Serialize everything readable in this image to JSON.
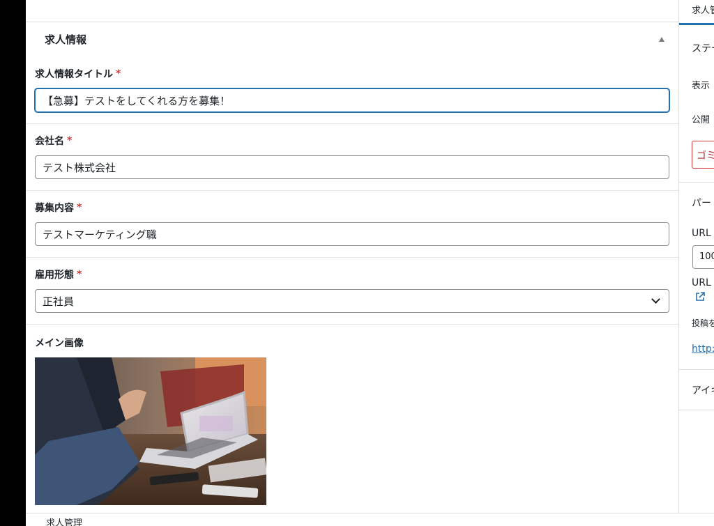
{
  "section": {
    "title": "求人情報"
  },
  "fields": {
    "job_title": {
      "label": "求人情報タイトル",
      "required_mark": "*",
      "value": "【急募】テストをしてくれる方を募集！"
    },
    "company": {
      "label": "会社名",
      "required_mark": "*",
      "value": "テスト株式会社"
    },
    "recruitment": {
      "label": "募集内容",
      "required_mark": "*",
      "value": "テストマーケティング職"
    },
    "employment_type": {
      "label": "雇用形態",
      "required_mark": "*",
      "value": "正社員"
    },
    "main_image": {
      "label": "メイン画像"
    }
  },
  "sidebar": {
    "tab": "求人管",
    "status": "ステー",
    "visibility": "表示",
    "publish": "公開",
    "trash": "ゴミ",
    "permalink": "パー",
    "url_label": "URL",
    "url_value": "100",
    "url_label2": "URL",
    "post_note": "投稿を",
    "link": "http:",
    "eyecatch": "アイキ"
  },
  "footer": {
    "text": "求人管理"
  },
  "colors": {
    "accent": "#2271b1",
    "required": "#d63638",
    "danger": "#b32d2e"
  }
}
